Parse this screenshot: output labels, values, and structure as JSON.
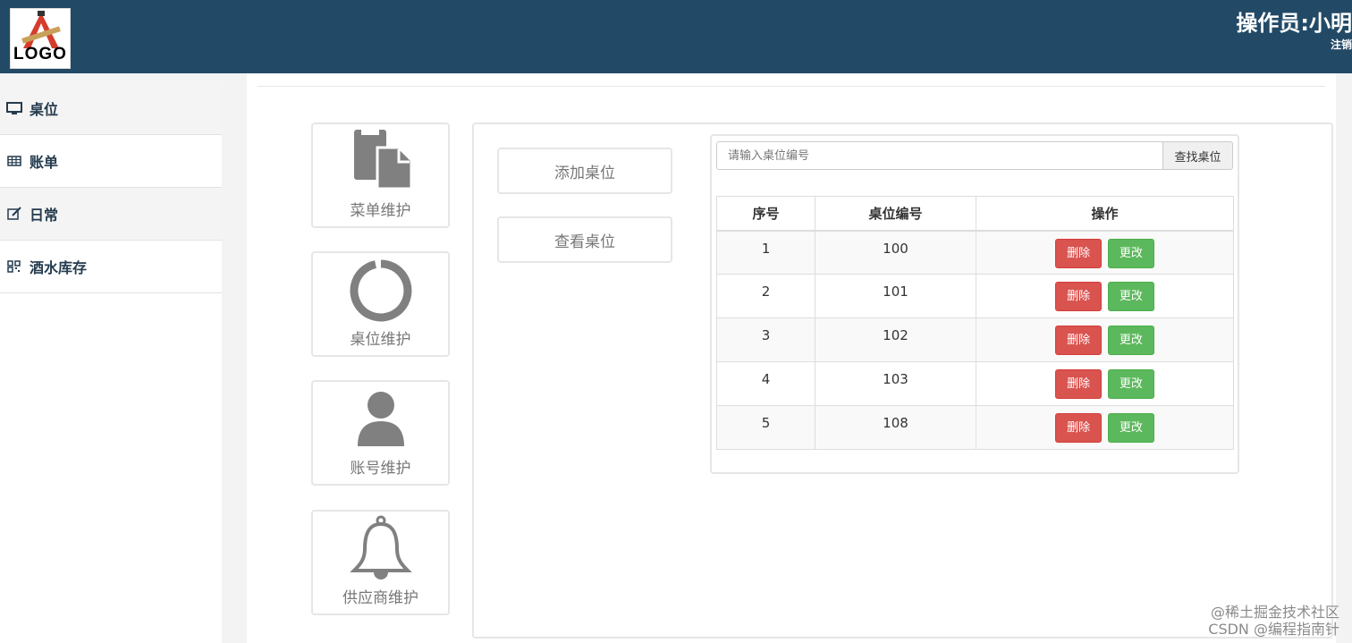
{
  "header": {
    "logo_text": "LOGO",
    "operator": "操作员:小明",
    "logout": "注销"
  },
  "sidebar": {
    "items": [
      {
        "label": "桌位",
        "icon": "monitor-icon"
      },
      {
        "label": "账单",
        "icon": "table-grid-icon"
      },
      {
        "label": "日常",
        "icon": "edit-icon"
      },
      {
        "label": "酒水库存",
        "icon": "qrcode-icon"
      }
    ]
  },
  "tiles": [
    {
      "label": "菜单维护",
      "icon": "document-copy-icon"
    },
    {
      "label": "桌位维护",
      "icon": "ring-icon"
    },
    {
      "label": "账号维护",
      "icon": "user-icon"
    },
    {
      "label": "供应商维护",
      "icon": "bell-icon"
    }
  ],
  "actions": {
    "add_table": "添加桌位",
    "view_table": "查看桌位"
  },
  "search": {
    "placeholder": "请输入桌位编号",
    "button": "查找桌位"
  },
  "table": {
    "columns": [
      "序号",
      "桌位编号",
      "操作"
    ],
    "rows": [
      {
        "index": "1",
        "number": "100"
      },
      {
        "index": "2",
        "number": "101"
      },
      {
        "index": "3",
        "number": "102"
      },
      {
        "index": "4",
        "number": "103"
      },
      {
        "index": "5",
        "number": "108"
      }
    ],
    "delete_label": "删除",
    "edit_label": "更改"
  },
  "watermark": {
    "line1": "@稀土掘金技术社区",
    "line2": "CSDN @编程指南针"
  },
  "colors": {
    "header_bg": "#224a66",
    "danger": "#d9534f",
    "success": "#5cb85c"
  }
}
